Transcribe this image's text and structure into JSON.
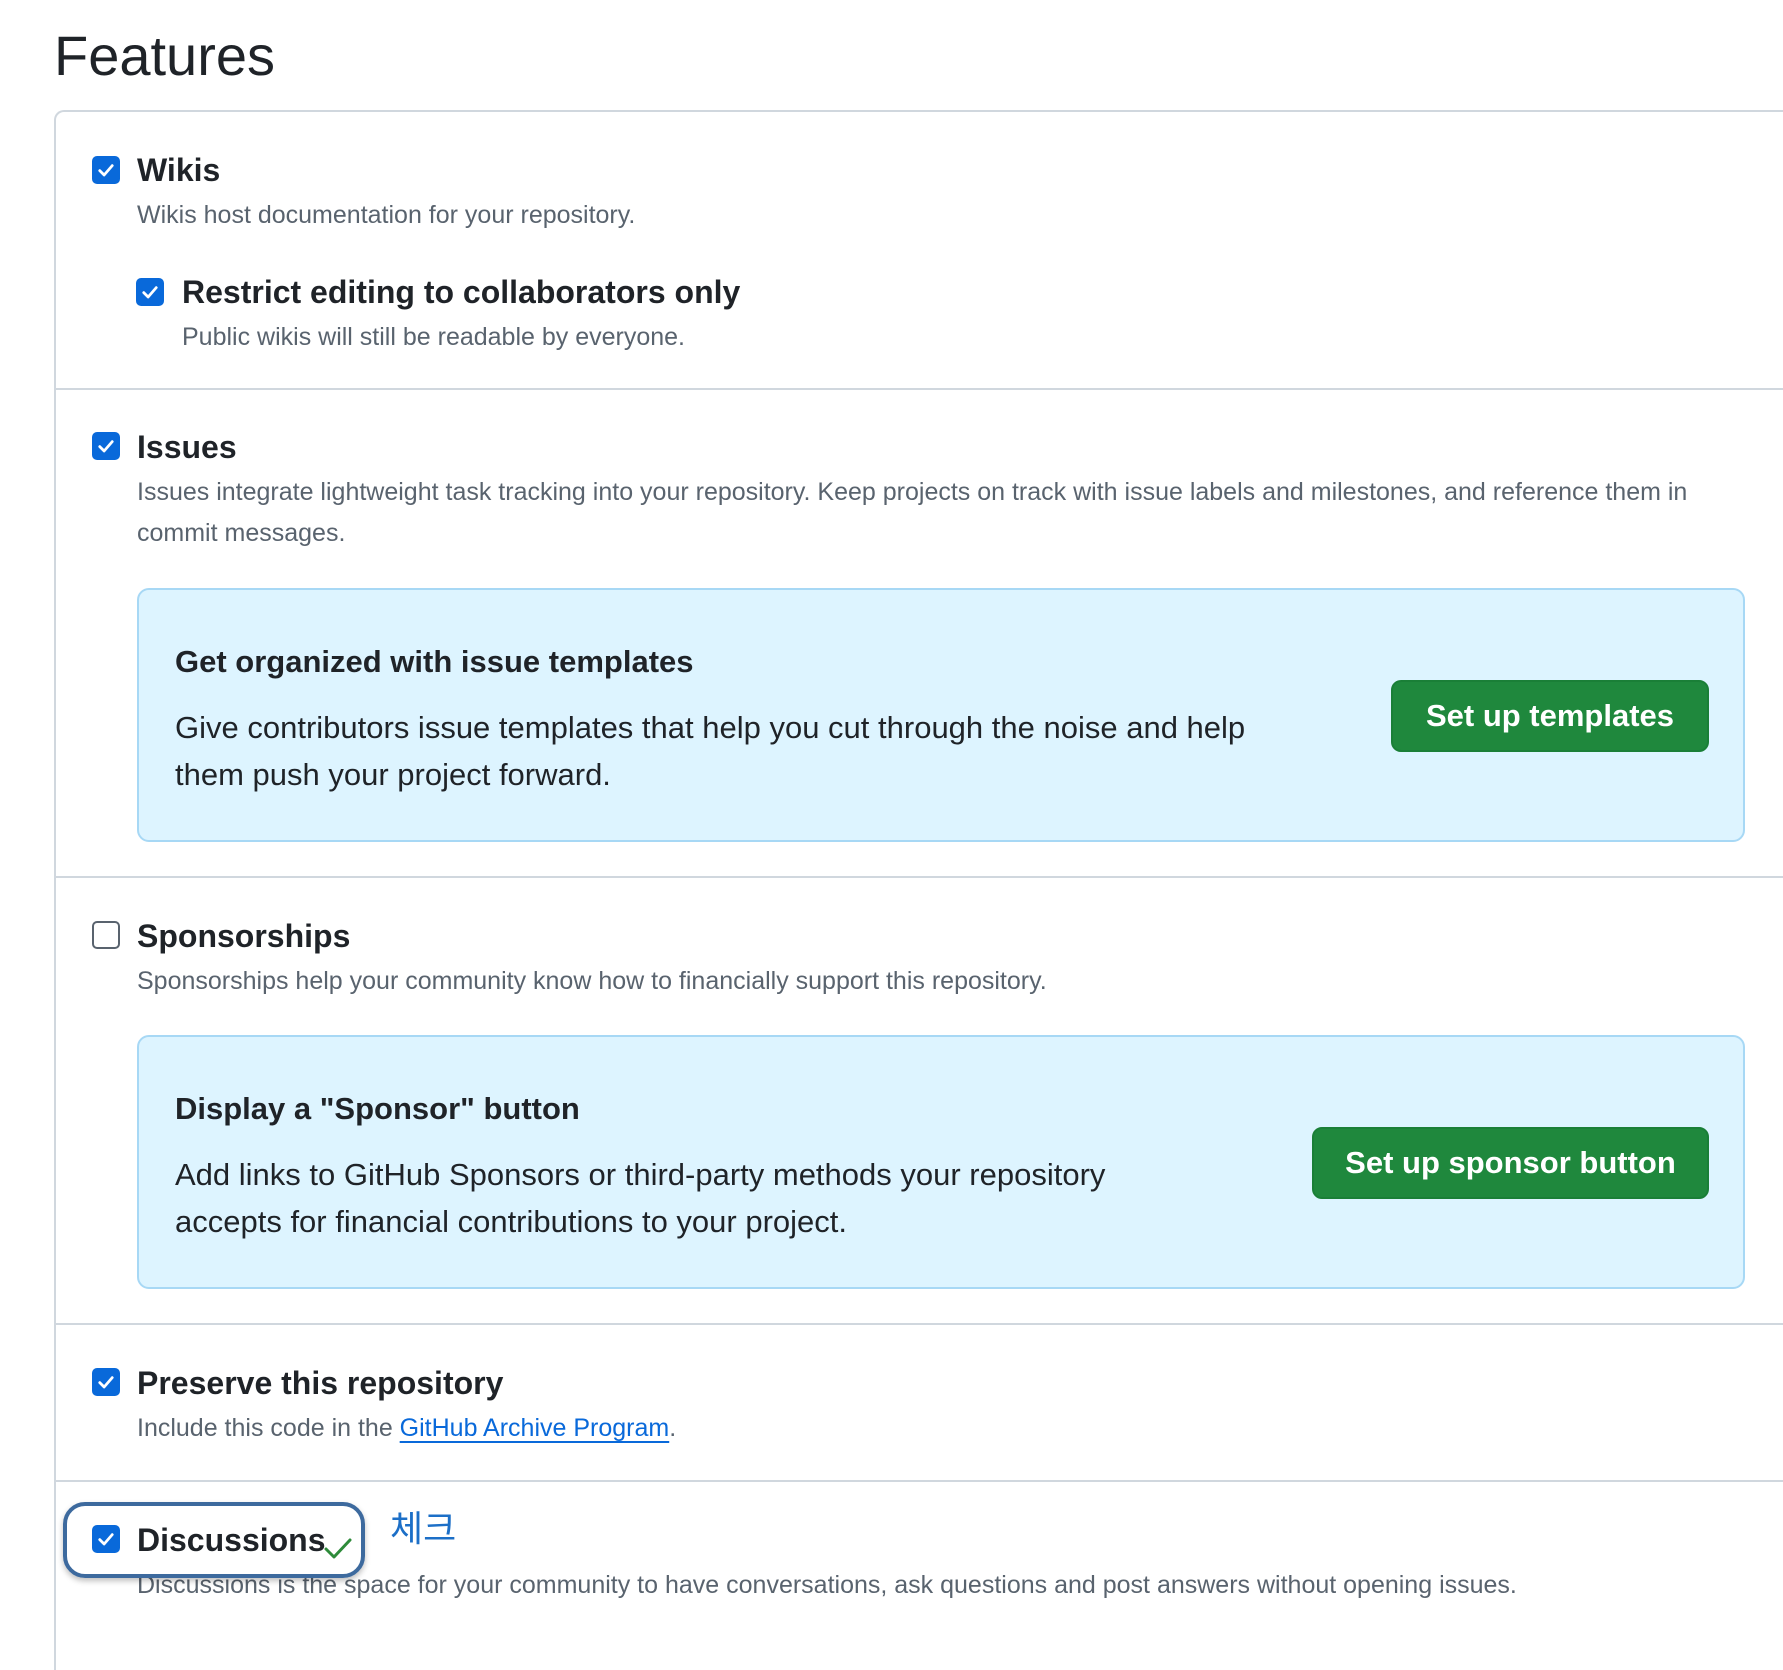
{
  "page": {
    "title": "Features"
  },
  "features": {
    "wikis": {
      "label": "Wikis",
      "description": "Wikis host documentation for your repository.",
      "checked": true,
      "restrict": {
        "label": "Restrict editing to collaborators only",
        "description": "Public wikis will still be readable by everyone.",
        "checked": true
      }
    },
    "issues": {
      "label": "Issues",
      "description": "Issues integrate lightweight task tracking into your repository. Keep projects on track with issue labels and milestones, and reference them in commit messages.",
      "checked": true,
      "callout": {
        "title": "Get organized with issue templates",
        "text": "Give contributors issue templates that help you cut through the noise and help them push your project forward.",
        "button_label": "Set up templates"
      }
    },
    "sponsorships": {
      "label": "Sponsorships",
      "description": "Sponsorships help your community know how to financially support this repository.",
      "checked": false,
      "callout": {
        "title": "Display a \"Sponsor\" button",
        "text": "Add links to GitHub Sponsors or third-party methods your repository accepts for financial contributions to your project.",
        "button_label": "Set up sponsor button"
      }
    },
    "preserve": {
      "label": "Preserve this repository",
      "description_prefix": "Include this code in the ",
      "link_text": "GitHub Archive Program",
      "description_suffix": ".",
      "checked": true
    },
    "discussions": {
      "label": "Discussions",
      "description": "Discussions is the space for your community to have conversations, ask questions and post answers without opening issues.",
      "checked": true
    }
  },
  "annotation": {
    "text": "체크",
    "check_icon": "check-icon"
  },
  "colors": {
    "accent_blue": "#0969da",
    "primary_green": "#1f883d",
    "callout_bg": "#ddf4ff",
    "annotation_blue": "#1c6fc7",
    "annotation_ring": "#3d6a9e"
  }
}
